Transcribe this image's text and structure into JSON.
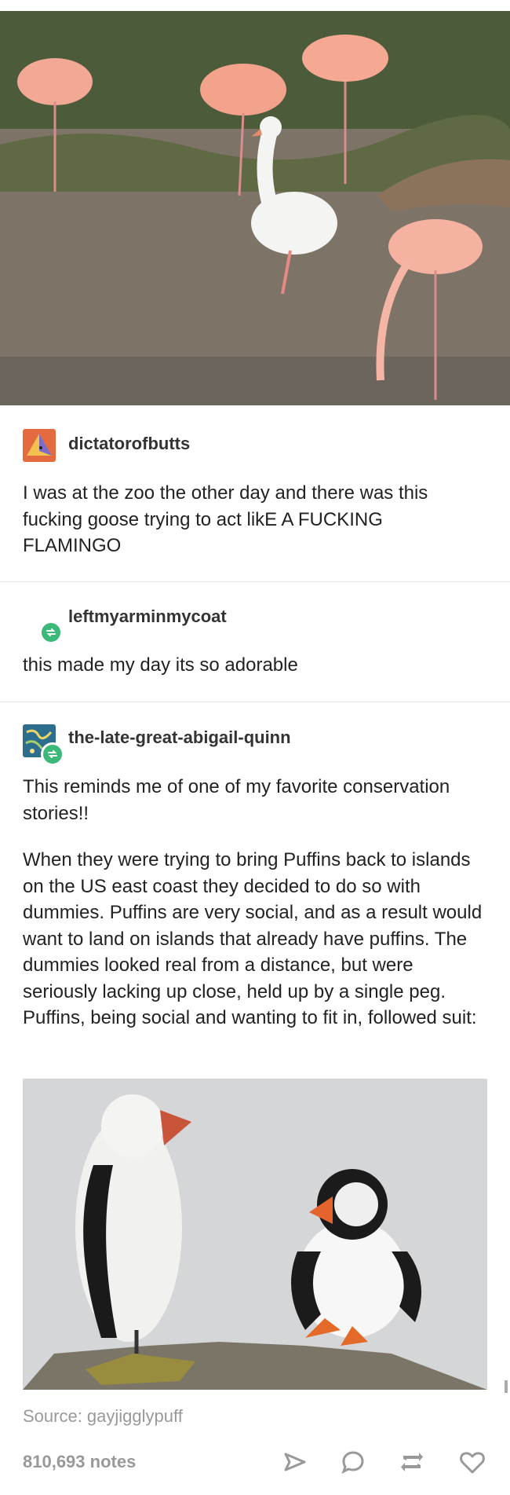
{
  "post": {
    "top_photo_alt": "goose among flamingos",
    "entries": [
      {
        "username": "dictatorofbutts",
        "text": "I was at the zoo the other day and there was this fucking goose trying to act likE A FUCKING FLAMINGO"
      },
      {
        "username": "leftmyarminmycoat",
        "text": "this made my day its so adorable"
      },
      {
        "username": "the-late-great-abigail-quinn",
        "text_1": "This reminds me of one of my favorite conservation stories!!",
        "text_2": "When they were trying to bring Puffins back to islands on the US east coast they decided to do so with dummies. Puffins are very social, and as a result would want to land on islands that already have puffins. The dummies looked real from a distance, but were seriously lacking up close, held up by a single peg. Puffins, being social and wanting to fit in, followed suit:"
      }
    ],
    "bottom_photo_alt": "puffin decoy next to a real puffin"
  },
  "footer": {
    "source": "Source: gayjigglypuff",
    "notes": "810,693 notes",
    "actions": [
      "share-icon",
      "reply-icon",
      "reblog-icon",
      "like-icon"
    ]
  },
  "colors": {
    "reblog_green": "#3cb878",
    "muted_text": "#999999"
  }
}
